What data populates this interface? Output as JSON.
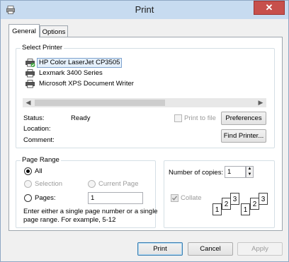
{
  "window": {
    "title": "Print",
    "close_glyph": "✕"
  },
  "tabs": [
    {
      "label": "General"
    },
    {
      "label": "Options"
    }
  ],
  "select_printer": {
    "title": "Select Printer",
    "printers": [
      {
        "label": "HP Color LaserJet CP3505",
        "icon": "printer-default-icon",
        "selected": true
      },
      {
        "label": "Lexmark 3400 Series",
        "icon": "printer-icon"
      },
      {
        "label": "Microsoft XPS Document Writer",
        "icon": "printer-icon"
      }
    ],
    "status_label": "Status:",
    "status_value": "Ready",
    "location_label": "Location:",
    "comment_label": "Comment:",
    "print_to_file_label": "Print to file",
    "preferences_label": "Preferences",
    "find_printer_label": "Find Printer..."
  },
  "page_range": {
    "title": "Page Range",
    "all_label": "All",
    "selection_label": "Selection",
    "current_page_label": "Current Page",
    "pages_label": "Pages:",
    "pages_value": "1",
    "help_text_line1": "Enter either a single page number or a single",
    "help_text_line2": "page range.  For example, 5-12"
  },
  "copies": {
    "number_label": "Number of copies:",
    "number_value": "1",
    "collate_label": "Collate",
    "collate_pages": [
      "1",
      "2",
      "3"
    ]
  },
  "footer": {
    "print_label": "Print",
    "cancel_label": "Cancel",
    "apply_label": "Apply"
  },
  "colors": {
    "titlebar": "#c7dbf0",
    "close": "#c7504c",
    "selection": "#e5f0fb"
  }
}
